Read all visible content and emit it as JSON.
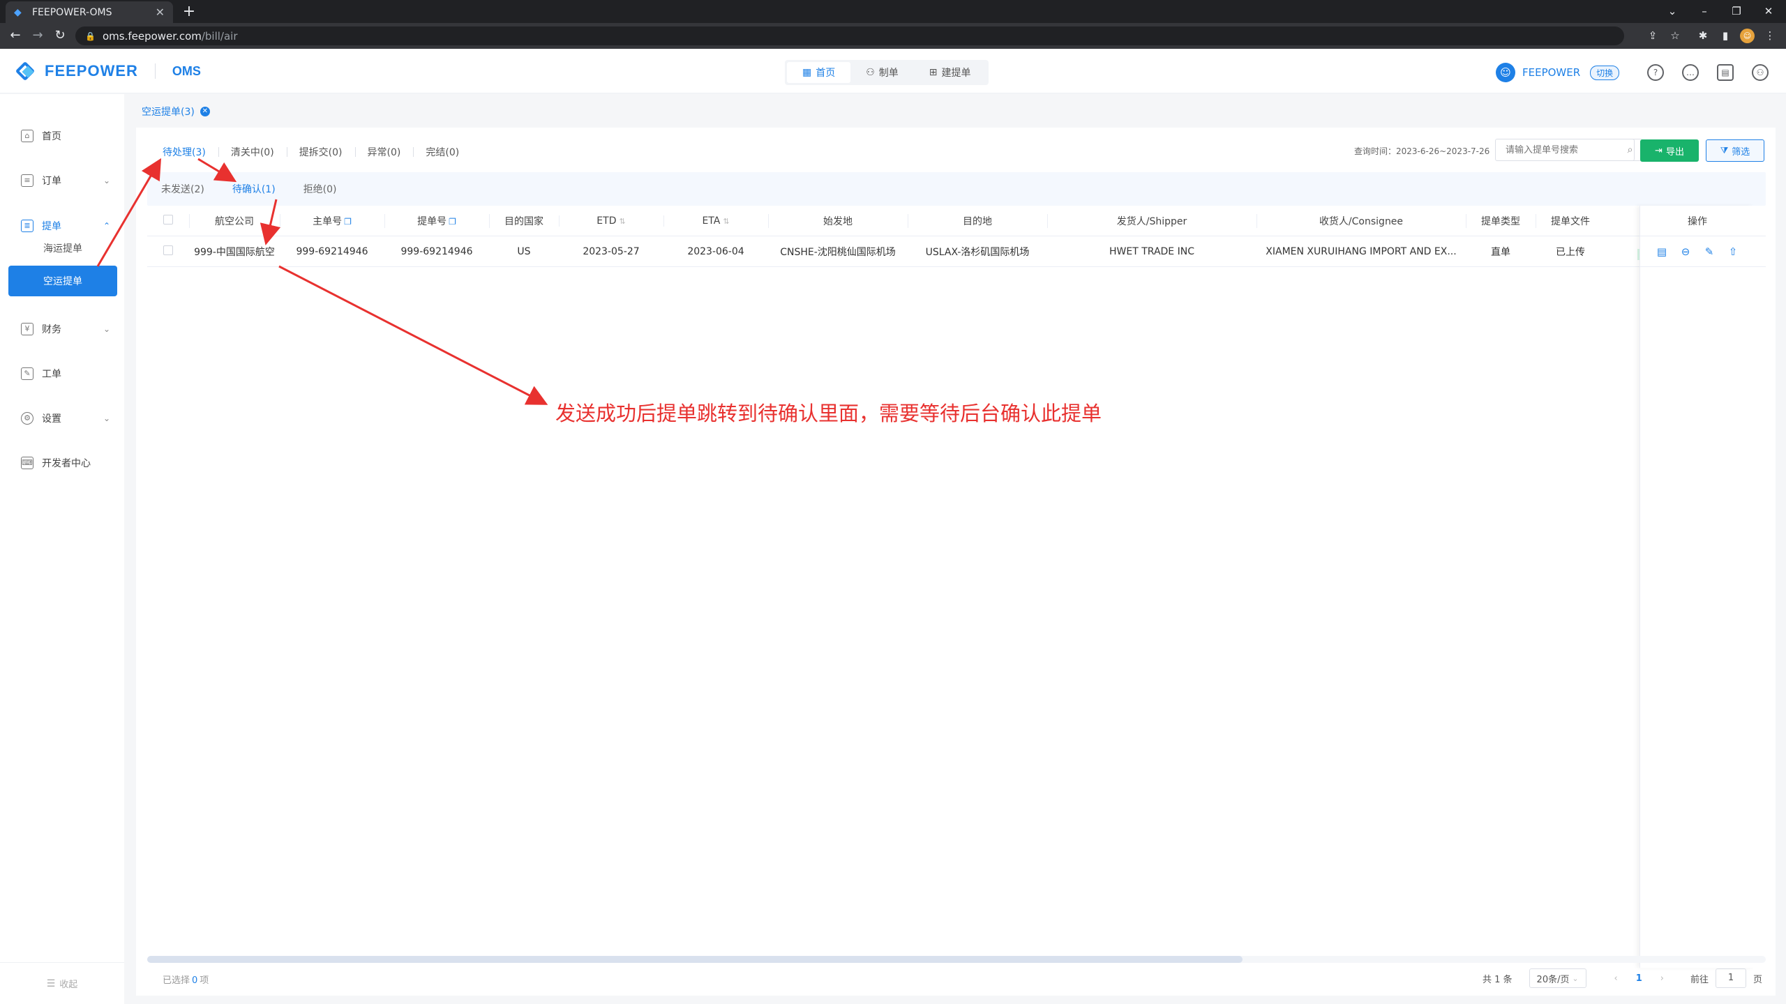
{
  "browser": {
    "tab_title": "FEEPOWER-OMS",
    "url_host": "oms.feepower.com",
    "url_path": "/bill/air"
  },
  "header": {
    "brand": "FEEPOWER",
    "system": "OMS",
    "nav": [
      {
        "label": "首页",
        "icon": "grid-icon",
        "active": true
      },
      {
        "label": "制单",
        "icon": "user-edit-icon",
        "active": false
      },
      {
        "label": "建提单",
        "icon": "doc-add-icon",
        "active": false
      }
    ],
    "user": "FEEPOWER",
    "switch_label": "切换"
  },
  "sidebar": {
    "items": [
      {
        "label": "首页",
        "icon": "home-icon"
      },
      {
        "label": "订单",
        "icon": "order-icon"
      },
      {
        "label": "提单",
        "icon": "bill-icon"
      },
      {
        "label": "海运提单",
        "icon": ""
      },
      {
        "label": "空运提单",
        "icon": ""
      },
      {
        "label": "财务",
        "icon": "finance-icon"
      },
      {
        "label": "工单",
        "icon": "ticket-icon"
      },
      {
        "label": "设置",
        "icon": "settings-icon"
      },
      {
        "label": "开发者中心",
        "icon": "developer-icon"
      }
    ],
    "collapse_label": "收起"
  },
  "breadcrumb": {
    "tag": "空运提单(3)"
  },
  "filters": {
    "tabs": [
      "待处理(3)",
      "清关中(0)",
      "提拆交(0)",
      "异常(0)",
      "完结(0)"
    ],
    "query_time": "查询时间：2023-6-26~2023-7-26",
    "search_placeholder": "请输入提单号搜索",
    "export_label": "导出",
    "filter_label": "筛选"
  },
  "subtabs": [
    "未发送(2)",
    "待确认(1)",
    "拒绝(0)"
  ],
  "table": {
    "headers": [
      "航空公司",
      "主单号",
      "提单号",
      "目的国家",
      "ETD",
      "ETA",
      "始发地",
      "目的地",
      "发货人/Shipper",
      "收货人/Consignee",
      "提单类型",
      "提单文件"
    ],
    "ops_header": "操作",
    "rows": [
      [
        "999-中国国际航空",
        "999-69214946",
        "999-69214946",
        "US",
        "2023-05-27",
        "2023-06-04",
        "CNSHE-沈阳桃仙国际机场",
        "USLAX-洛杉矶国际机场",
        "HWET TRADE INC",
        "XIAMEN XURUIHANG IMPORT AND EX...",
        "直单",
        "已上传"
      ]
    ]
  },
  "footer": {
    "selected_prefix": "已选择",
    "selected_count": "0",
    "selected_suffix": "项",
    "total": "共 1 条",
    "page_size": "20条/页",
    "current_page": "1",
    "goto_label": "前往",
    "goto_value": "1",
    "page_suffix": "页"
  },
  "annotation": {
    "text": "发送成功后提单跳转到待确认里面，需要等待后台确认此提单",
    "color": "#e8312f"
  }
}
